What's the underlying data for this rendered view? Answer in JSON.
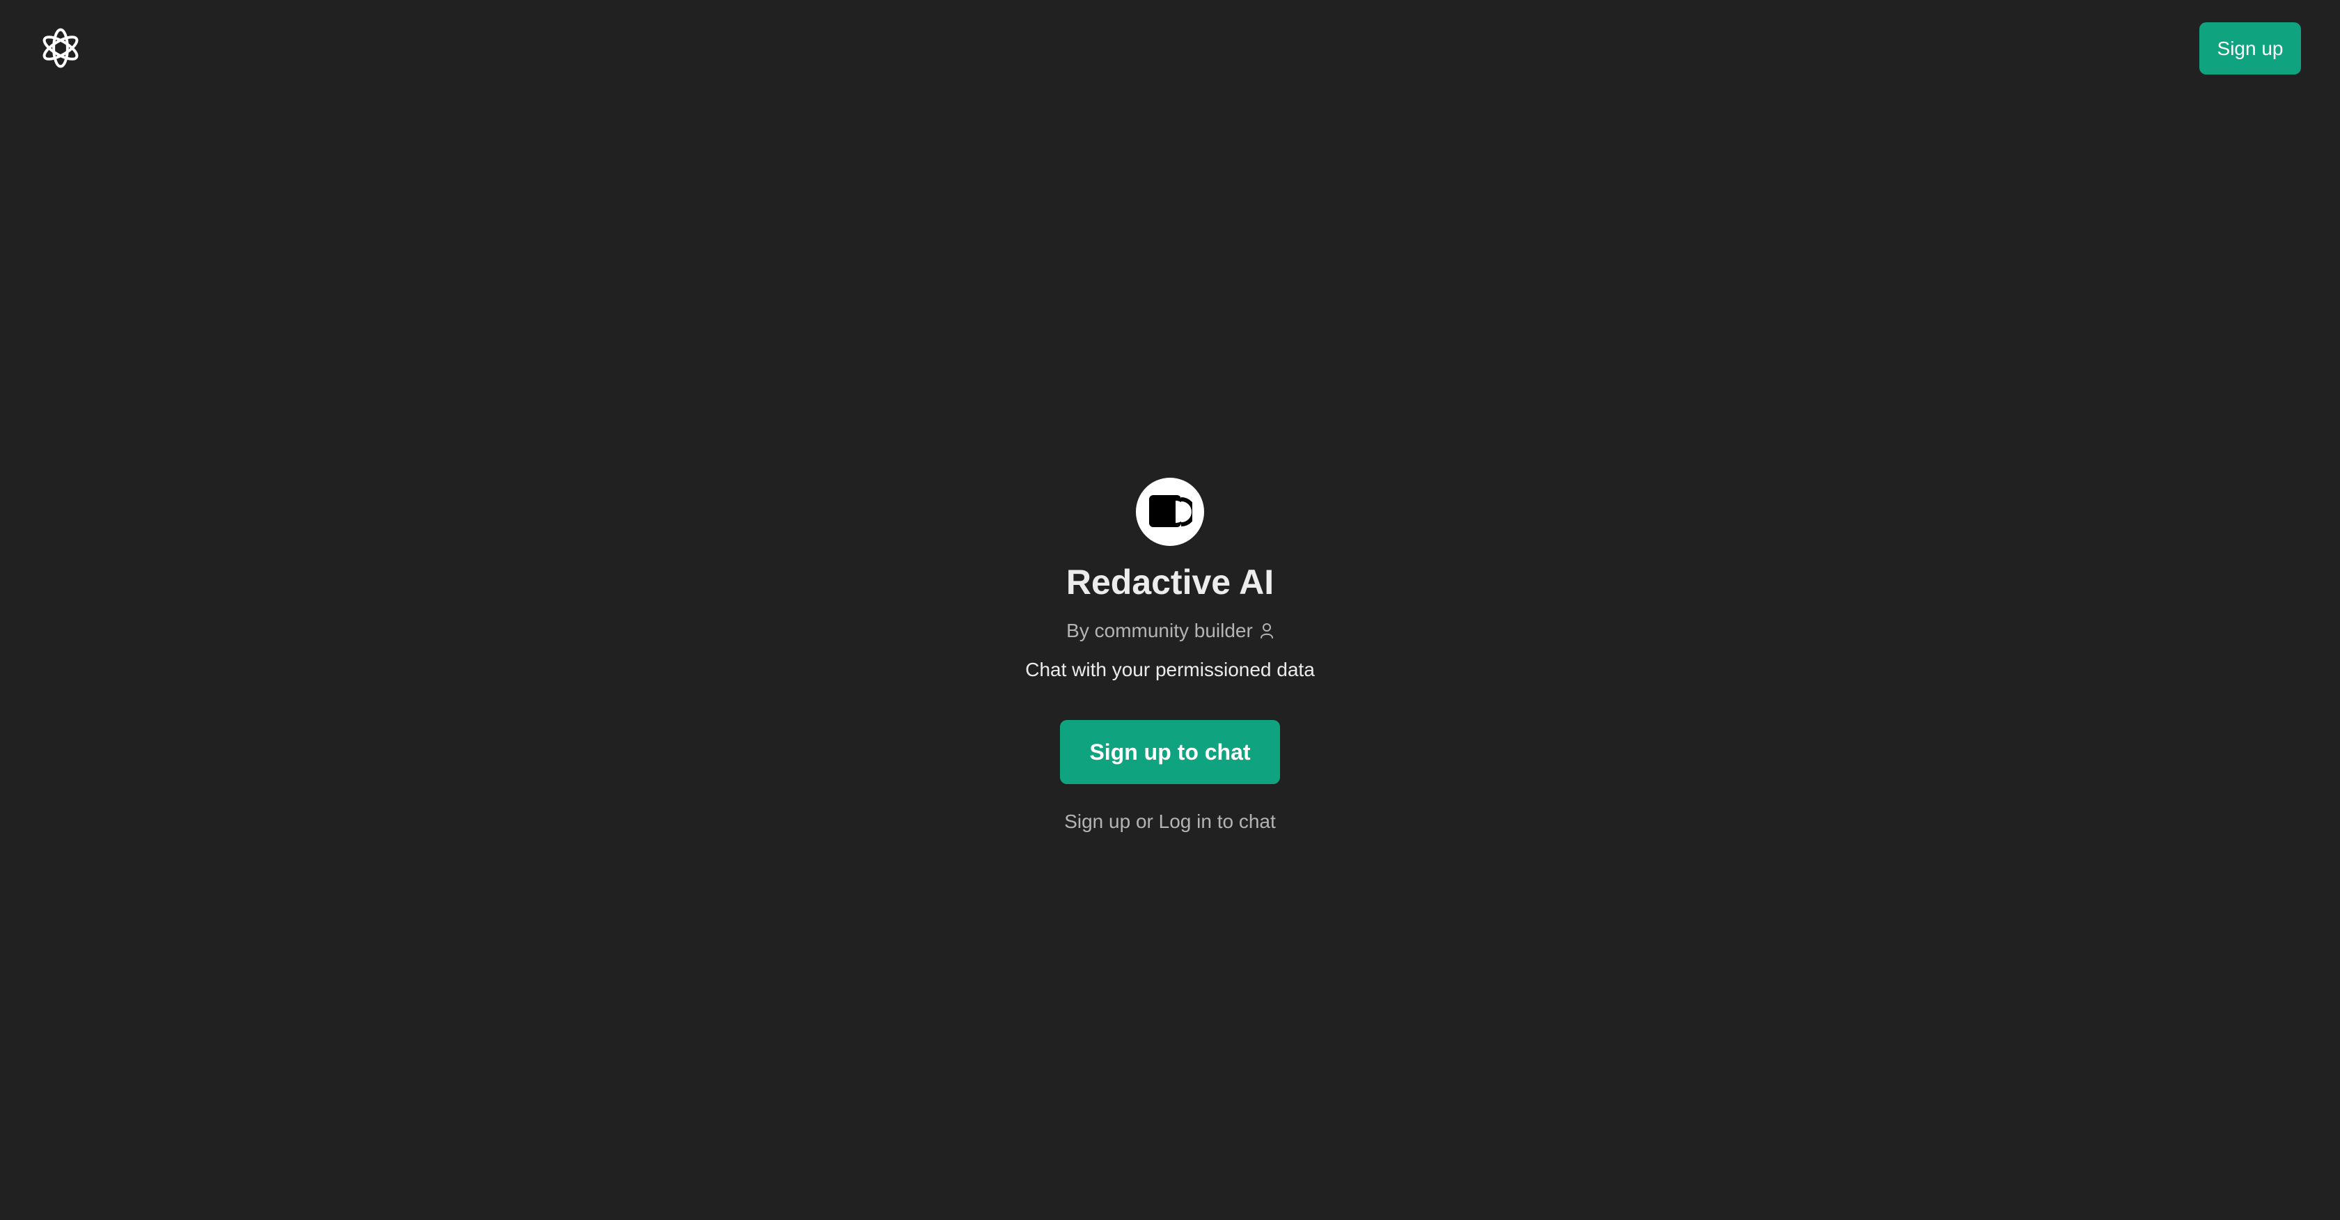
{
  "header": {
    "logo_icon": "openai-logo-icon",
    "signup_label": "Sign up"
  },
  "gpt": {
    "avatar_icon": "redactive-logo-icon",
    "name": "Redactive AI",
    "byline": "By community builder",
    "byline_icon": "user-icon",
    "description": "Chat with your permissioned data"
  },
  "cta": {
    "primary_label": "Sign up to chat",
    "signup_link": "Sign up",
    "separator": "or",
    "login_link": "Log in",
    "suffix": "to chat"
  },
  "colors": {
    "background": "#212121",
    "accent": "#10a37f",
    "text_primary": "#ececec",
    "text_secondary": "#b4b4b4"
  }
}
